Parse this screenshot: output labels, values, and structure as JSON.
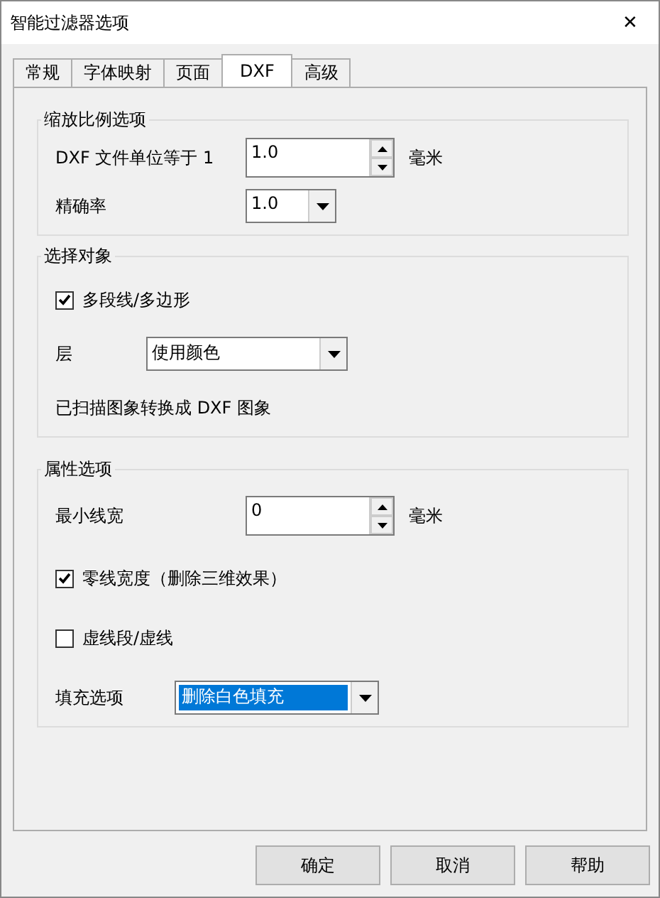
{
  "window": {
    "title": "智能过滤器选项",
    "close": "✕"
  },
  "tabs": [
    {
      "label": "常规",
      "selected": false
    },
    {
      "label": "字体映射",
      "selected": false
    },
    {
      "label": "页面",
      "selected": false
    },
    {
      "label": "DXF",
      "selected": true
    },
    {
      "label": "高级",
      "selected": false
    }
  ],
  "groups": [
    {
      "title": "缩放比例选项",
      "rows": [
        {
          "kind": "spin",
          "label": "DXF 文件单位等于 1",
          "value": "1.0",
          "unit": "毫米"
        },
        {
          "kind": "combo",
          "label": "精确率",
          "value": "1.0",
          "selected": false
        }
      ]
    },
    {
      "title": "选择对象",
      "rows": [
        {
          "kind": "check",
          "label": "多段线/多边形",
          "checked": true
        },
        {
          "kind": "combo",
          "label": "层",
          "value": "使用颜色",
          "selected": false
        },
        {
          "kind": "text",
          "label": "已扫描图象转换成 DXF 图象"
        }
      ]
    },
    {
      "title": "属性选项",
      "rows": [
        {
          "kind": "spin",
          "label": "最小线宽",
          "value": "0",
          "unit": "毫米"
        },
        {
          "kind": "check",
          "label": "零线宽度（删除三维效果）",
          "checked": true
        },
        {
          "kind": "check",
          "label": "虚线段/虚线",
          "checked": false
        },
        {
          "kind": "combo",
          "label": "填充选项",
          "value": "删除白色填充",
          "selected": true
        }
      ]
    }
  ],
  "buttons": [
    "确定",
    "取消",
    "帮助"
  ]
}
